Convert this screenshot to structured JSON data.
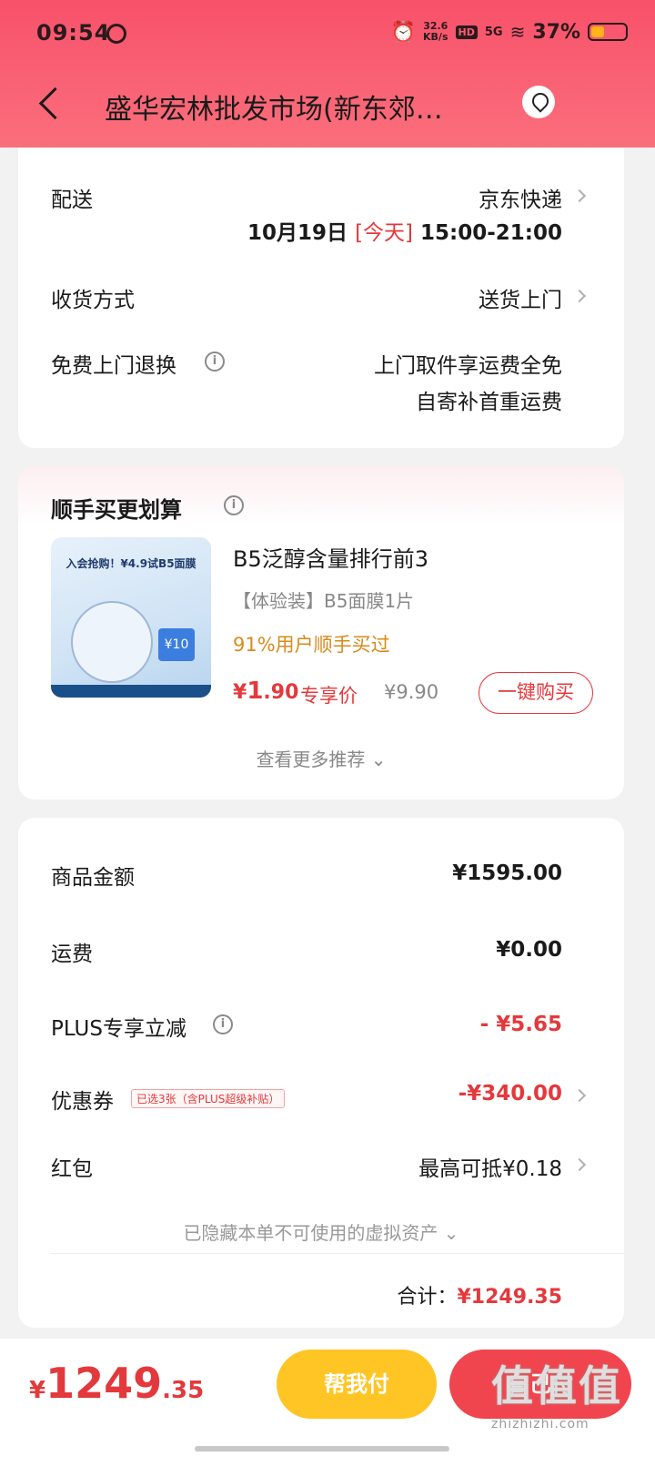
{
  "status_bar": {
    "time": "09:54",
    "net_speed": "32.6",
    "net_unit": "KB/s",
    "hd": "HD",
    "signal": "5G",
    "battery_pct": "37%"
  },
  "nav": {
    "title": "盛华宏林批发市场(新东郊…"
  },
  "delivery": {
    "ship_label": "配送",
    "ship_value": "京东快递",
    "date": "10月19日",
    "today": "[今天]",
    "time_window": "15:00-21:00",
    "receive_label": "收货方式",
    "receive_value": "送货上门",
    "return_label": "免费上门退换",
    "return_line1": "上门取件享运费全免",
    "return_line2": "自寄补首重运费"
  },
  "recommend": {
    "title": "顺手买更划算",
    "product_name": "B5泛醇含量排行前3",
    "product_spec": "【体验装】B5面膜1片",
    "popularity": "91%用户顺手买过",
    "price_symbol": "¥",
    "price_int": "1",
    "price_dec": ".90",
    "price_tag": "专享价",
    "orig_price": "¥9.90",
    "buy_button": "一键购买",
    "more": "查看更多推荐 ⌄",
    "image_texts": {
      "banner": "入会抢购！¥4.9试B5面膜",
      "coupon": "¥10"
    }
  },
  "summary": {
    "goods_label": "商品金额",
    "goods_value": "¥1595.00",
    "freight_label": "运费",
    "freight_value": "¥0.00",
    "plus_label": "PLUS专享立减",
    "plus_value": "- ¥5.65",
    "coupon_label": "优惠券",
    "coupon_tag": "已选3张（含PLUS超级补贴）",
    "coupon_value": "-¥340.00",
    "redpacket_label": "红包",
    "redpacket_value": "最高可抵¥0.18",
    "hidden_assets": "已隐藏本单不可使用的虚拟资产 ⌄",
    "total_label": "合计：",
    "total_value": "¥1249.35"
  },
  "bottom": {
    "currency": "¥",
    "amount_int": "1249",
    "amount_dec": ".35",
    "help_pay": "帮我付",
    "self_pay": "自己付"
  },
  "watermark": {
    "big": "值值值",
    "small": "zhizhizhi.com"
  },
  "colors": {
    "accent_red": "#e4393c",
    "header_pink": "#f8516a",
    "help_yellow": "#ffc524",
    "popularity_orange": "#d98a1c"
  }
}
